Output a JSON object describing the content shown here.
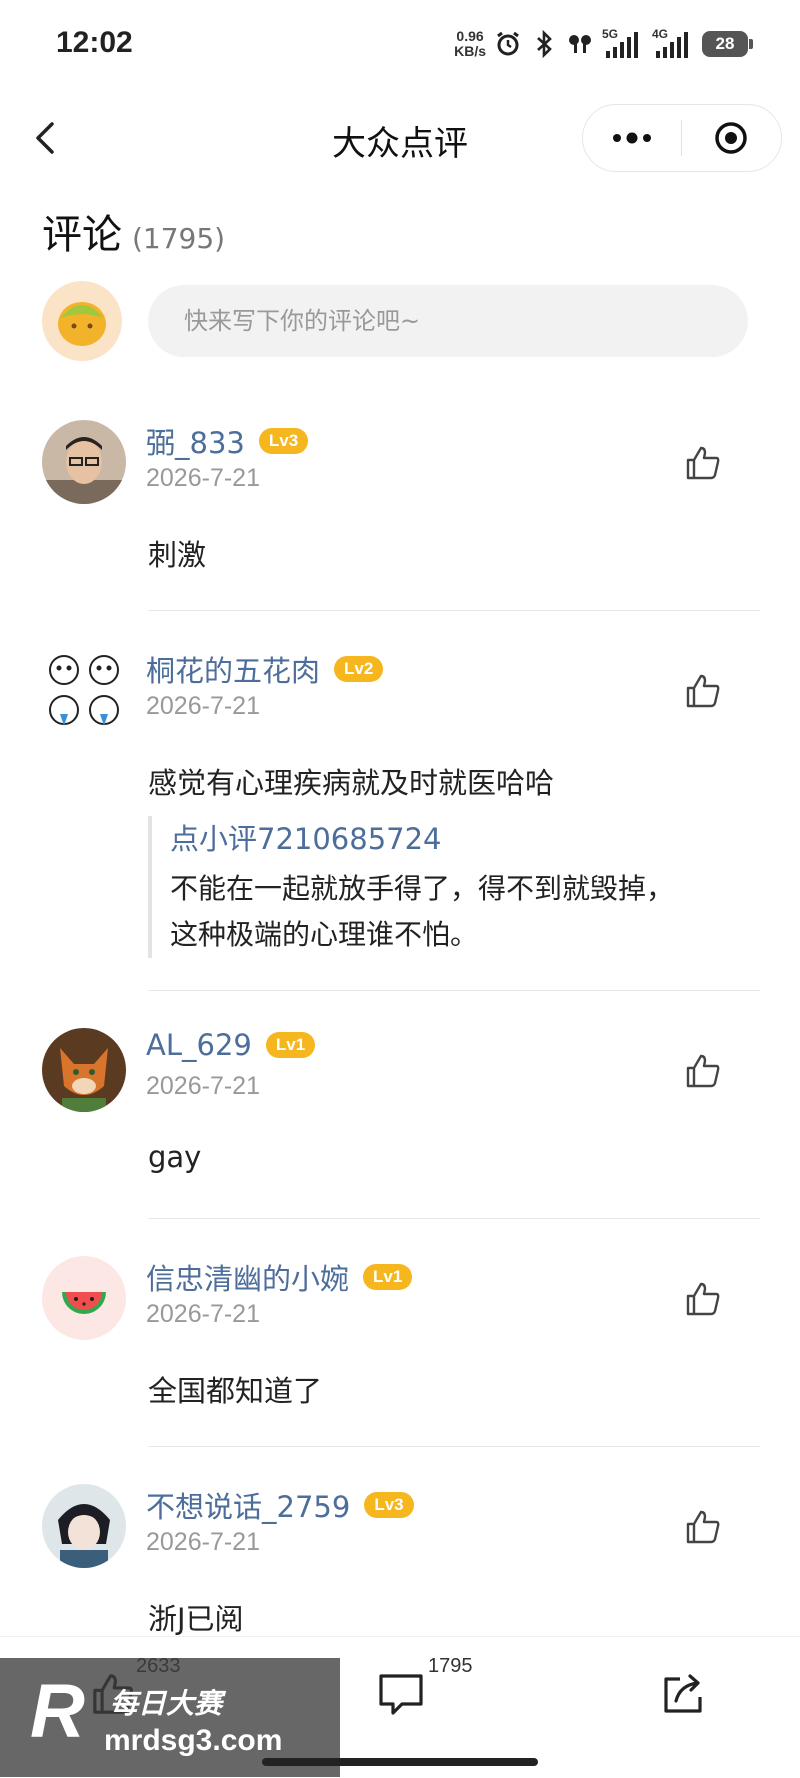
{
  "status_bar": {
    "time": "12:02",
    "net_speed_value": "0.96",
    "net_speed_unit": "KB/s",
    "sig1_label": "5G",
    "sig2_label": "4G",
    "battery": "28"
  },
  "nav": {
    "title": "大众点评"
  },
  "section": {
    "title": "评论",
    "count": "(1795)"
  },
  "composer": {
    "placeholder": "快来写下你的评论吧~"
  },
  "comments": [
    {
      "name": "弼_833",
      "level": "Lv3",
      "date": "2026-7-21",
      "text": "刺激"
    },
    {
      "name": "桐花的五花肉",
      "level": "Lv2",
      "date": "2026-7-21",
      "text": "感觉有心理疾病就及时就医哈哈",
      "quote": {
        "author": "点小评7210685724",
        "line1": "不能在一起就放手得了，得不到就毁掉，",
        "line2": "这种极端的心理谁不怕。"
      }
    },
    {
      "name": "AL_629",
      "level": "Lv1",
      "date": "2026-7-21",
      "text": "gay"
    },
    {
      "name": "信忠清幽的小婉",
      "level": "Lv1",
      "date": "2026-7-21",
      "text": "全国都知道了"
    },
    {
      "name": "不想说话_2759",
      "level": "Lv3",
      "date": "2026-7-21",
      "text": "浙J已阅"
    }
  ],
  "bottom_bar": {
    "like_count": "2633",
    "comment_count": "1795"
  },
  "watermark": {
    "logo": "R",
    "cn": "每日大赛",
    "url": "mrdsg3.com"
  },
  "colors": {
    "name_link": "#4d6e9a",
    "level_badge": "#f5b61e",
    "date": "#999999"
  }
}
